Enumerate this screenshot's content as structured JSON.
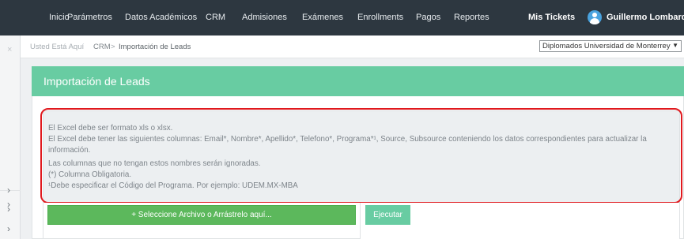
{
  "nav": {
    "items": [
      "Inicio",
      "Parámetros",
      "Datos Académicos",
      "CRM",
      "Admisiones",
      "Exámenes",
      "Enrollments",
      "Pagos",
      "Reportes"
    ],
    "tickets": "Mis Tickets",
    "user": "Guillermo Lombardi"
  },
  "sidebar": {
    "close": "×",
    "chevron": "›"
  },
  "breadcrumb": {
    "prefix": "Usted Está Aquí",
    "crm": "CRM",
    "separator": ">",
    "current": "Importación de Leads"
  },
  "program_select": {
    "value": "Diplomados Universidad de Monterrey",
    "caret": "▼"
  },
  "panel": {
    "title": "Importación de Leads"
  },
  "info": {
    "line1": "El Excel debe ser formato xls o xlsx.",
    "line2": "El Excel debe tener las siguientes columnas: Email*, Nombre*, Apellido*, Telefono*, Programa*¹, Source, Subsource conteniendo los datos correspondientes para actualizar la",
    "line3": "información.",
    "line4": "Las columnas que no tengan estos nombres serán ignoradas.",
    "line5": "(*) Columna Obligatoria.",
    "line6": "¹Debe especificar el Código del Programa. Por ejemplo: UDEM.MX-MBA"
  },
  "actions": {
    "upload": "+ Seleccione Archivo o Arrástrelo aquí...",
    "execute": "Ejecutar"
  },
  "colors": {
    "nav_bg": "#2d3740",
    "panel_header": "#68cca2",
    "upload_button": "#5cb85c",
    "highlight": "#e0191e"
  }
}
